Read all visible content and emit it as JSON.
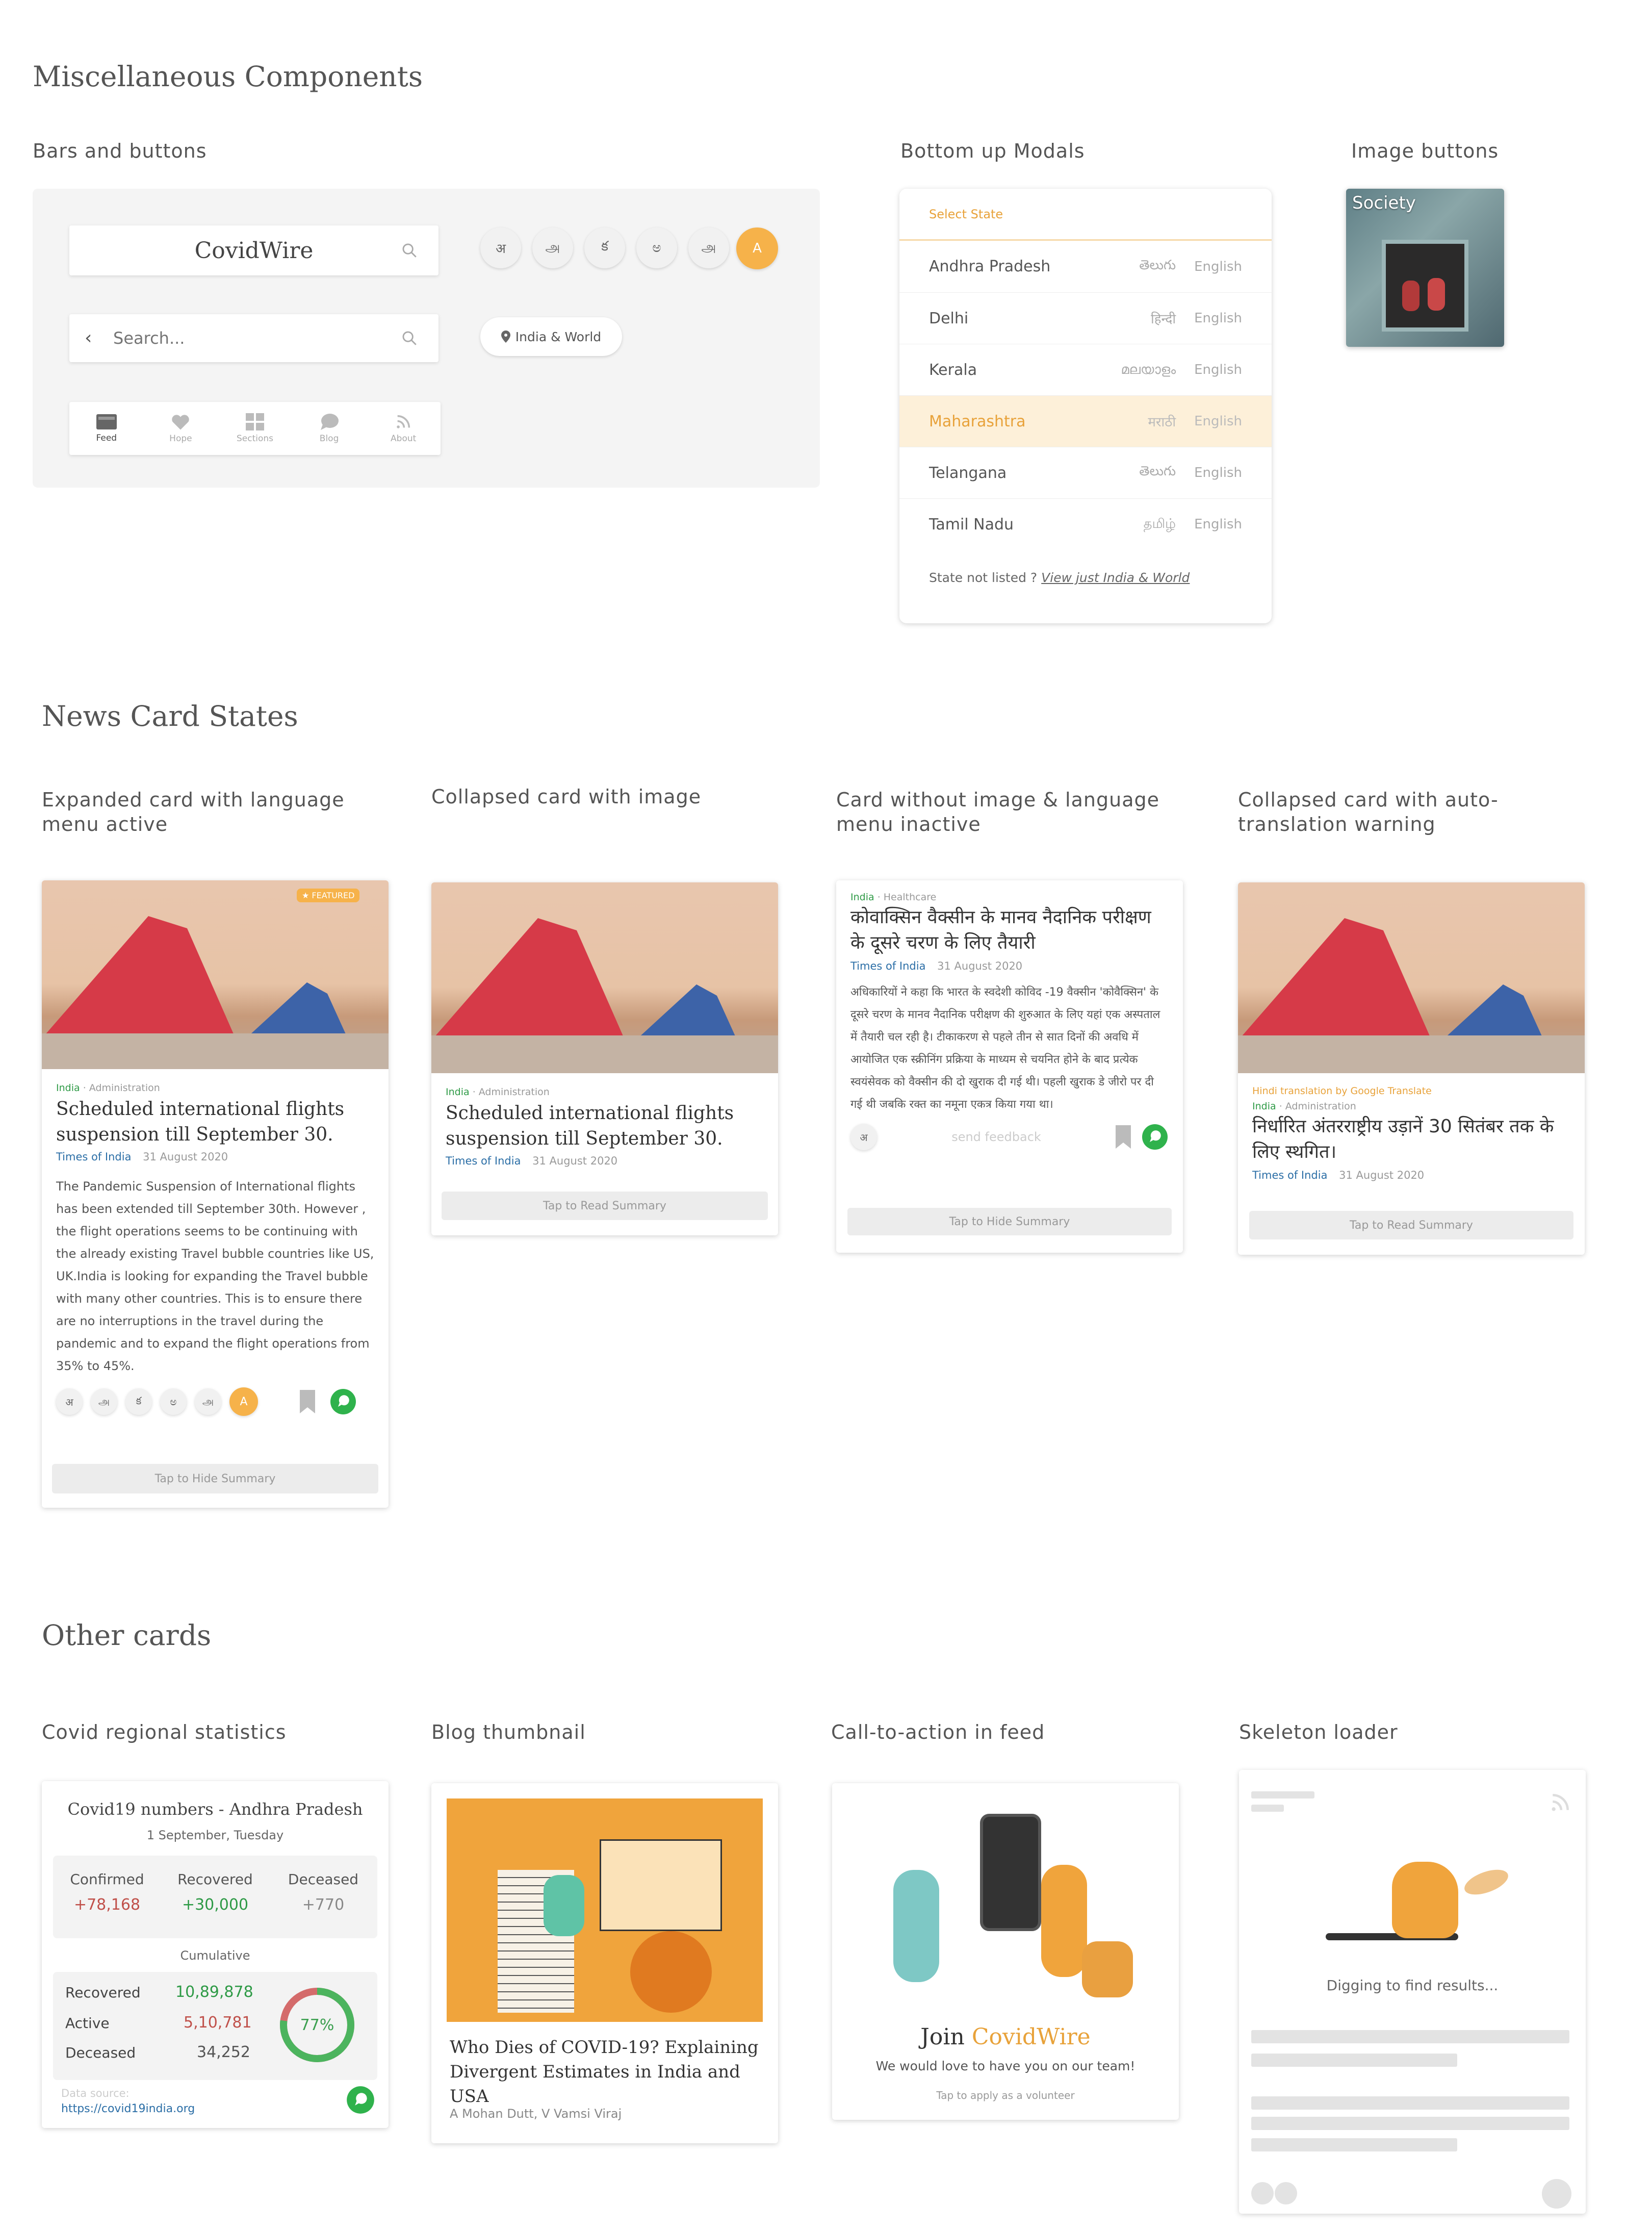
{
  "sections": {
    "misc": "Miscellaneous Components",
    "news": "News Card States",
    "other": "Other cards"
  },
  "subs": {
    "bars": "Bars and buttons",
    "modals": "Bottom up Modals",
    "imgbtn": "Image buttons",
    "expanded": "Expanded card with language menu active",
    "collapsed_img": "Collapsed card with image",
    "no_img": "Card without image & language menu inactive",
    "auto_trans": "Collapsed card with auto-translation warning",
    "covid_stats": "Covid regional statistics",
    "blog": "Blog thumbnail",
    "cta": "Call-to-action in feed",
    "skeleton": "Skeleton loader"
  },
  "bars": {
    "brand": "CovidWire",
    "search_placeholder": "Search...",
    "languages": [
      "अ",
      "அ",
      "క",
      "ಅ",
      "அ",
      "A"
    ],
    "location_chip": "India & World",
    "nav": [
      {
        "label": "Feed",
        "icon": "feed-icon"
      },
      {
        "label": "Hope",
        "icon": "heart-icon"
      },
      {
        "label": "Sections",
        "icon": "grid-icon"
      },
      {
        "label": "Blog",
        "icon": "chat-bubble-icon"
      },
      {
        "label": "About",
        "icon": "rss-icon"
      }
    ]
  },
  "modal": {
    "title": "Select State",
    "states": [
      {
        "name": "Andhra Pradesh",
        "native": "తెలుగు",
        "en": "English"
      },
      {
        "name": "Delhi",
        "native": "हिन्दी",
        "en": "English"
      },
      {
        "name": "Kerala",
        "native": "മലയാളം",
        "en": "English"
      },
      {
        "name": "Maharashtra",
        "native": "मराठी",
        "en": "English"
      },
      {
        "name": "Telangana",
        "native": "తెలుగు",
        "en": "English"
      },
      {
        "name": "Tamil Nadu",
        "native": "தமிழ்",
        "en": "English"
      }
    ],
    "footer_text": "State not listed ?",
    "footer_link": "View just India & World"
  },
  "image_button": {
    "label": "Society"
  },
  "card_expanded": {
    "badge": "★ FEATURED",
    "tag_a": "India",
    "tag_b": "· Administration",
    "title": "Scheduled international flights suspension till September 30.",
    "source": "Times of India",
    "date": "31 August 2020",
    "summary": "The Pandemic Suspension of International flights has been extended till September 30th. However , the flight operations seems to be continuing with the already existing Travel bubble countries like US, UK.India is looking for expanding the Travel bubble with many other countries. This is to ensure there are no interruptions in the travel during the pandemic and to expand the flight operations from 35% to 45%.",
    "languages": [
      "अ",
      "அ",
      "క",
      "ಅ",
      "அ",
      "A"
    ],
    "action": "Tap to Hide Summary"
  },
  "card_collapsed": {
    "tag_a": "India",
    "tag_b": "· Administration",
    "title": "Scheduled international flights suspension till September 30.",
    "source": "Times of India",
    "date": "31 August 2020",
    "action": "Tap to Read Summary"
  },
  "card_noimg": {
    "tag_a": "India",
    "tag_b": "· Healthcare",
    "title": "कोवाक्सिन वैक्सीन के मानव नैदानिक परीक्षण के दूसरे चरण के लिए तैयारी",
    "source": "Times of India",
    "date": "31 August 2020",
    "summary": "अधिकारियों ने कहा कि भारत के स्वदेशी कोविद -19 वैक्सीन 'कोवैक्सिन' के दूसरे चरण के मानव नैदानिक परीक्षण की शुरुआत के लिए यहां एक अस्पताल में तैयारी चल रही है। टीकाकरण से पहले तीन से सात दिनों की अवधि में आयोजित एक स्क्रीनिंग प्रक्रिया के माध्यम से चयनित होने के बाद प्रत्येक स्वयंसेवक को वैक्सीन की दो खुराक दी गई थी। पहली खुराक डे जीरो पर दी गई थी जबकि रक्त का नमूना एकत्र किया गया था।",
    "lang": "अ",
    "feedback": "send feedback",
    "action": "Tap to Hide Summary"
  },
  "card_translated": {
    "warning": "Hindi translation by Google Translate",
    "tag_a": "India",
    "tag_b": "· Administration",
    "title": "निर्धारित अंतरराष्ट्रीय उड़ानें 30 सितंबर तक के लिए स्थगित।",
    "source": "Times of India",
    "date": "31 August 2020",
    "action": "Tap to Read Summary"
  },
  "stats": {
    "title": "Covid19 numbers - Andhra Pradesh",
    "date": "1 September, Tuesday",
    "daily": [
      {
        "label": "Confirmed",
        "value": "+78,168",
        "color": "#c0504a"
      },
      {
        "label": "Recovered",
        "value": "+30,000",
        "color": "#2e9a46"
      },
      {
        "label": "Deceased",
        "value": "+770",
        "color": "#888888"
      }
    ],
    "cumulative_label": "Cumulative",
    "cumulative": [
      {
        "label": "Recovered",
        "value": "10,89,878",
        "color": "#2e9a46"
      },
      {
        "label": "Active",
        "value": "5,10,781",
        "color": "#c0504a"
      },
      {
        "label": "Deceased",
        "value": "34,252",
        "color": "#555555"
      }
    ],
    "ring_label": "77%",
    "ring_fraction": 0.77,
    "source_label": "Data source:",
    "source_link": "https://covid19india.org"
  },
  "blog": {
    "title": "Who Dies of COVID-19? Explaining Divergent Estimates in India and USA",
    "authors": "A Mohan Dutt, V Vamsi Viraj"
  },
  "cta": {
    "join": "Join",
    "brand": "CovidWire",
    "text": "We would love to have you on our team!",
    "action": "Tap to apply as a volunteer"
  },
  "skeleton": {
    "text": "Digging to find results..."
  },
  "colors": {
    "accent": "#f6b24a",
    "green": "#2e9a46",
    "blue": "#2b6ea6",
    "red": "#c0504a"
  }
}
